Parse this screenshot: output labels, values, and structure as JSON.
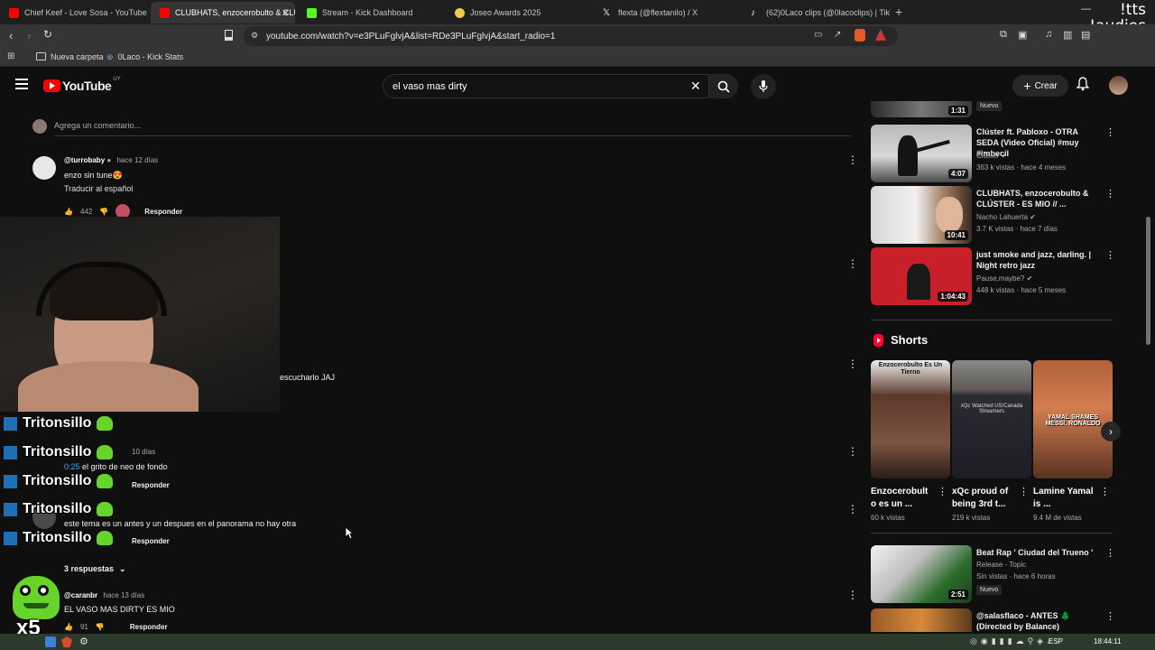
{
  "browser": {
    "tabs": [
      {
        "title": "Chief Keef - Love Sosa - YouTube",
        "color": "#ff0000",
        "active": false
      },
      {
        "title": "CLUBHATS, enzocerobulto & CLÚ",
        "color": "#ff0000",
        "active": true
      },
      {
        "title": "Stream - Kick Dashboard",
        "color": "#53fc18",
        "active": false
      },
      {
        "title": "Joseo Awards 2025",
        "color": "#f2c94c",
        "active": false
      },
      {
        "title": "flexta (@flextanilo) / X",
        "color": "#ffffff",
        "active": false
      },
      {
        "title": "(62)0Laco clips (@0lacoclips) | TikTok",
        "color": "#ffffff",
        "active": false
      }
    ],
    "url": "youtube.com/watch?v=e3PLuFglvjA&list=RDe3PLuFglvjA&start_radio=1",
    "bookmarks": [
      {
        "label": "Nueva carpeta"
      },
      {
        "label": "0Laco - Kick Stats"
      }
    ],
    "watermark": "!tts\n!audios"
  },
  "youtube": {
    "logo_text": "YouTube",
    "country": "UY",
    "search_value": "el vaso mas dirty",
    "create_label": "Crear",
    "add_comment_placeholder": "Agrega un comentario..."
  },
  "comments": [
    {
      "author": "@turrobaby",
      "time": "hace 12 días",
      "text": "enzo sin tune😍",
      "translate": "Traducir al español",
      "likes": "442",
      "reply": "Responder"
    },
    {
      "text_partial": "escucharlo JAJ"
    },
    {
      "time": "10 días",
      "text": "0:25 el grito de neo de fondo",
      "timestamp": "0:25",
      "reply": "Responder"
    },
    {
      "text": "este tema es un antes y un despues en el panorama no hay otra",
      "reply": "Responder",
      "replies_label": "3 respuestas"
    },
    {
      "author": "@caranbr",
      "time": "hace 13 días",
      "text": "EL VASO MAS DIRTY ES MIO",
      "likes": "91",
      "reply": "Responder"
    }
  ],
  "sidebar": {
    "top_partial": {
      "duration": "1:31",
      "badge": "Nuevo"
    },
    "videos": [
      {
        "title": "Clúster ft. Pabloxo - OTRA SEDA (Video Oficial) #muy #imbecil",
        "channel": "Clúster",
        "meta": "363 k vistas · hace 4 meses",
        "duration": "4:07"
      },
      {
        "title": "CLUBHATS, enzocerobulto & CLÚSTER - ES MIO // ...",
        "channel": "Nacho Lahuerta",
        "meta": "3.7 K vistas · hace 7 días",
        "duration": "10:41"
      },
      {
        "title": "just smoke and jazz, darling. | Night retro jazz",
        "channel": "Pause,maybe?",
        "meta": "448 k vistas · hace 5 meses",
        "duration": "1:04:43"
      }
    ],
    "shorts_heading": "Shorts",
    "shorts": [
      {
        "title": "Enzocerobult o es un ...",
        "views": "60 k vistas",
        "overlay": "Enzocerobulto Es Un Tierno"
      },
      {
        "title": "xQc proud of being 3rd t...",
        "views": "219 k vistas",
        "overlay": "xQc Watched US/Canada Streamers"
      },
      {
        "title": "Lamine Yamal is ...",
        "views": "9.4 M de vistas",
        "overlay": "YAMAL SHAMES MESSI, RONALDO"
      }
    ],
    "bottom_videos": [
      {
        "title": "Beat Rap ' Ciudad del Trueno '",
        "channel": "Release - Topic",
        "meta": "Sin vistas · hace 6 horas",
        "badge": "Nuevo",
        "duration": "2:51"
      },
      {
        "title": "@salasflaco - ANTES 🌲 (Directed by Balance)"
      }
    ]
  },
  "stream_overlay": {
    "chat_user": "Tritonsillo",
    "multiplier": "x5",
    "multiplier_color": "#66d42a"
  },
  "taskbar": {
    "lang": "ESP",
    "clock": "18:44:11"
  }
}
